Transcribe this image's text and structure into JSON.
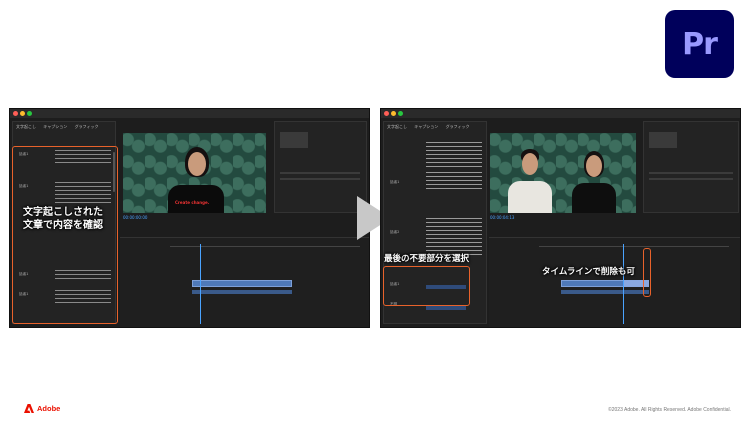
{
  "app": {
    "logo_text": "Pr",
    "logo_color": "#00005b",
    "logo_text_color": "#9999ff"
  },
  "left_panel": {
    "tabs": [
      "文字起こし",
      "キャプション",
      "グラフィック",
      "文字起こし"
    ],
    "speaker_labels": [
      "話者1",
      "話者1",
      "話者1",
      "話者1"
    ],
    "timecode": "00:00:00:00",
    "callout": {
      "line1": "文字起こしされた",
      "line2": "文章で内容を確認"
    },
    "overlay_caption": "Create change."
  },
  "right_panel": {
    "tabs": [
      "文字起こし",
      "キャプション",
      "グラフィック",
      "文字起こし"
    ],
    "speaker_labels": [
      "話者1",
      "話者2",
      "話者1",
      "不明"
    ],
    "timecode": "00:00:04:13",
    "callout_select": "最後の不要部分を選択",
    "callout_timeline": "タイムラインで削除も可"
  },
  "transition": {
    "icon": "play-arrow-icon"
  },
  "footer": {
    "brand": "Adobe",
    "brand_color": "#eb1000",
    "copyright": "©2023 Adobe. All Rights Reserved. Adobe Confidential."
  },
  "colors": {
    "highlight_orange": "#e8622b",
    "premiere_dark": "#1d1d1d"
  }
}
